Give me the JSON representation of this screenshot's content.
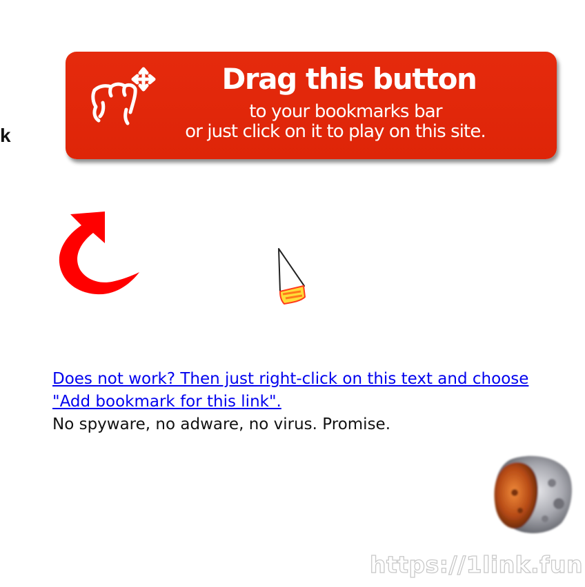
{
  "left_fragment": "k",
  "bookmarklet": {
    "title": "Drag this button",
    "line2": "to your bookmarks bar",
    "line3": "or just click on it to play on this site.",
    "icon": "drag-hand-icon",
    "color": "#e22a0c"
  },
  "help": {
    "link_text": "Does not work? Then just right-click on this text and choose \"Add bookmark for this link\".",
    "promise": "No spyware, no adware, no virus. Promise."
  },
  "decorations": {
    "arrow_icon": "curved-arrow-icon",
    "cursor_icon": "rocket-cursor-icon",
    "asteroid_icon": "asteroid-icon",
    "arrow_color": "#ff0000"
  },
  "watermark": "https://1link.fun"
}
